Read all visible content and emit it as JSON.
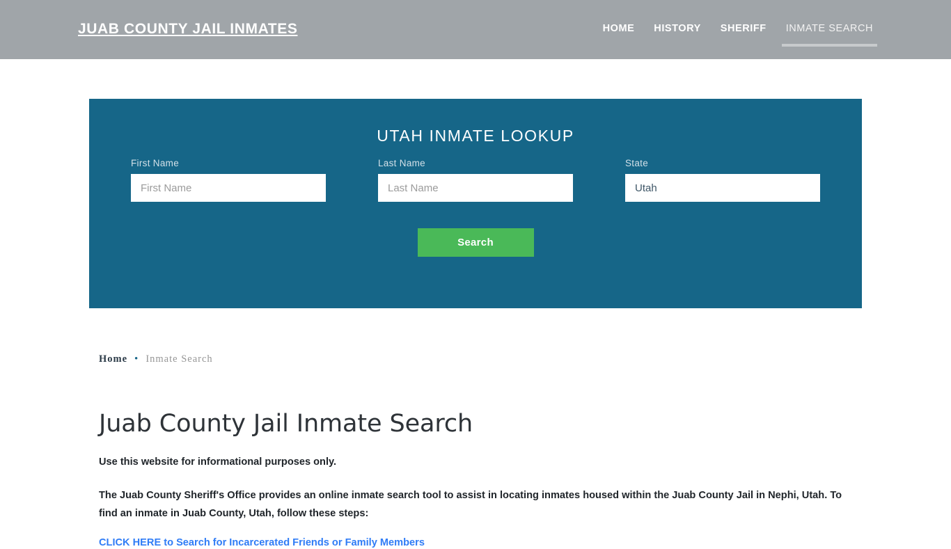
{
  "header": {
    "brand": "JUAB COUNTY JAIL INMATES",
    "nav": [
      {
        "label": "HOME",
        "active": false
      },
      {
        "label": "HISTORY",
        "active": false
      },
      {
        "label": "SHERIFF",
        "active": false
      },
      {
        "label": "INMATE SEARCH",
        "active": true
      }
    ]
  },
  "search_panel": {
    "title": "UTAH INMATE LOOKUP",
    "fields": [
      {
        "label": "First Name",
        "placeholder": "First Name",
        "value": ""
      },
      {
        "label": "Last Name",
        "placeholder": "Last Name",
        "value": ""
      },
      {
        "label": "State",
        "placeholder": "",
        "value": "Utah"
      }
    ],
    "submit_label": "Search",
    "accent_color": "#166688",
    "button_color": "#4ab958"
  },
  "breadcrumb": {
    "home": "Home",
    "separator": "•",
    "current": "Inmate Search"
  },
  "main": {
    "title": "Juab County Jail Inmate Search",
    "intro": "Use this website for informational purposes only.",
    "paragraph": "The Juab County Sheriff's Office provides an online inmate search tool to assist in locating inmates housed within the Juab County Jail in Nephi, Utah. To find an inmate in Juab County, Utah, follow these steps:",
    "cta_link": "CLICK HERE to Search for Incarcerated Friends or Family Members",
    "link_color": "#2f7cf6"
  }
}
